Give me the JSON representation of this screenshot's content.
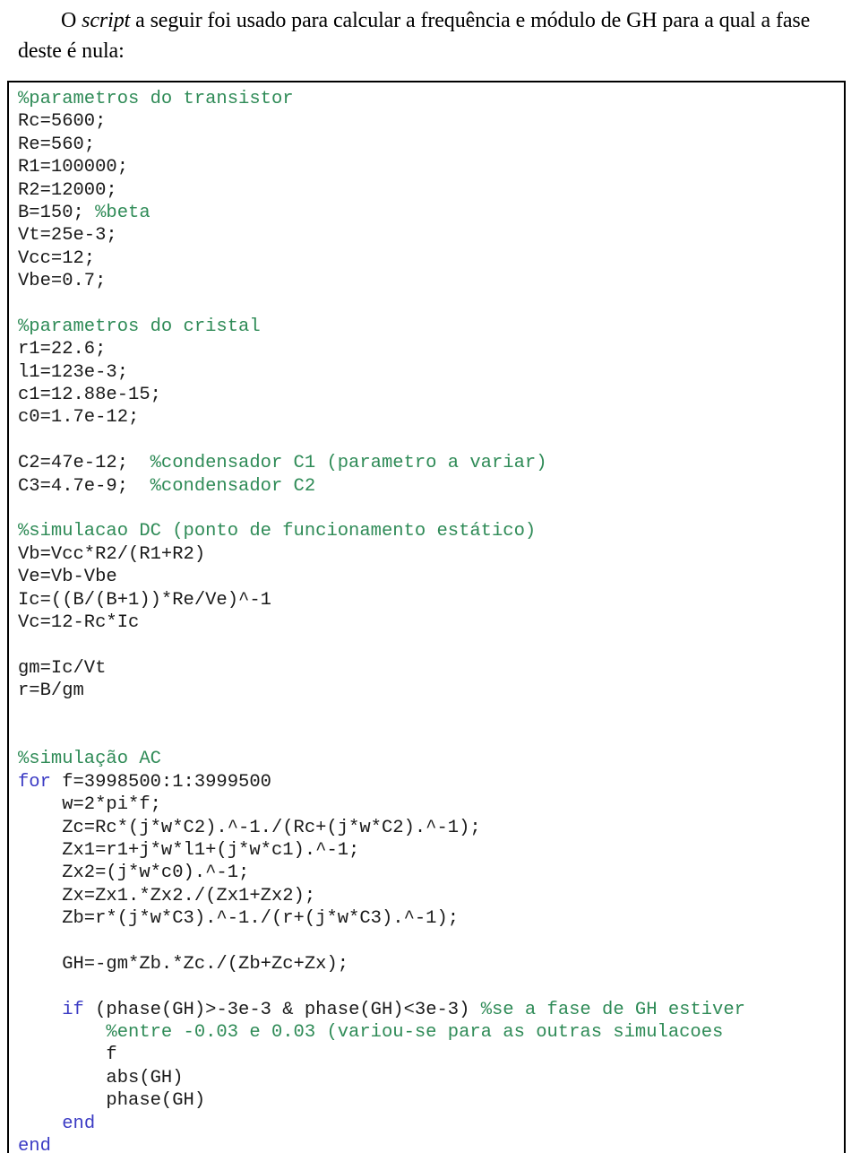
{
  "intro": {
    "before_italic": "O ",
    "italic_word": "script",
    "after_italic": " a seguir foi usado para calcular a frequência e módulo de GH para a qual a fase deste é nula:"
  },
  "colors": {
    "comment": "#2f8b57",
    "keyword": "#3b3bc4",
    "code": "#1a1a1a",
    "border": "#000000",
    "background": "#ffffff"
  },
  "code": {
    "language": "MATLAB",
    "lines": [
      {
        "type": "comment",
        "text": "%parametros do transistor"
      },
      {
        "type": "code",
        "text": "Rc=5600;"
      },
      {
        "type": "code",
        "text": "Re=560;"
      },
      {
        "type": "code",
        "text": "R1=100000;"
      },
      {
        "type": "code",
        "text": "R2=12000;"
      },
      {
        "type": "mixed",
        "code": "B=150; ",
        "comment": "%beta"
      },
      {
        "type": "code",
        "text": "Vt=25e-3;"
      },
      {
        "type": "code",
        "text": "Vcc=12;"
      },
      {
        "type": "code",
        "text": "Vbe=0.7;"
      },
      {
        "type": "blank",
        "text": ""
      },
      {
        "type": "comment",
        "text": "%parametros do cristal"
      },
      {
        "type": "code",
        "text": "r1=22.6;"
      },
      {
        "type": "code",
        "text": "l1=123e-3;"
      },
      {
        "type": "code",
        "text": "c1=12.88e-15;"
      },
      {
        "type": "code",
        "text": "c0=1.7e-12;"
      },
      {
        "type": "blank",
        "text": ""
      },
      {
        "type": "mixed",
        "code": "C2=47e-12;  ",
        "comment": "%condensador C1 (parametro a variar)"
      },
      {
        "type": "mixed",
        "code": "C3=4.7e-9;  ",
        "comment": "%condensador C2"
      },
      {
        "type": "blank",
        "text": ""
      },
      {
        "type": "comment",
        "text": "%simulacao DC (ponto de funcionamento estático)"
      },
      {
        "type": "code",
        "text": "Vb=Vcc*R2/(R1+R2)"
      },
      {
        "type": "code",
        "text": "Ve=Vb-Vbe"
      },
      {
        "type": "code",
        "text": "Ic=((B/(B+1))*Re/Ve)^-1"
      },
      {
        "type": "code",
        "text": "Vc=12-Rc*Ic"
      },
      {
        "type": "blank",
        "text": ""
      },
      {
        "type": "code",
        "text": "gm=Ic/Vt"
      },
      {
        "type": "code",
        "text": "r=B/gm"
      },
      {
        "type": "blank",
        "text": ""
      },
      {
        "type": "blank",
        "text": ""
      },
      {
        "type": "comment",
        "text": "%simulação AC"
      },
      {
        "type": "kwstart",
        "keyword": "for",
        "text": " f=3998500:1:3999500"
      },
      {
        "type": "code",
        "text": "    w=2*pi*f;"
      },
      {
        "type": "code",
        "text": "    Zc=Rc*(j*w*C2).^-1./(Rc+(j*w*C2).^-1);"
      },
      {
        "type": "code",
        "text": "    Zx1=r1+j*w*l1+(j*w*c1).^-1;"
      },
      {
        "type": "code",
        "text": "    Zx2=(j*w*c0).^-1;"
      },
      {
        "type": "code",
        "text": "    Zx=Zx1.*Zx2./(Zx1+Zx2);"
      },
      {
        "type": "code",
        "text": "    Zb=r*(j*w*C3).^-1./(r+(j*w*C3).^-1);"
      },
      {
        "type": "blank",
        "text": ""
      },
      {
        "type": "code",
        "text": "    GH=-gm*Zb.*Zc./(Zb+Zc+Zx);"
      },
      {
        "type": "blank",
        "text": ""
      },
      {
        "type": "kwmixed",
        "indent": "    ",
        "keyword": "if",
        "code": " (phase(GH)>-3e-3 & phase(GH)<3e-3) ",
        "comment": "%se a fase de GH estiver"
      },
      {
        "type": "comment",
        "text": "        %entre -0.03 e 0.03 (variou-se para as outras simulacoes"
      },
      {
        "type": "code",
        "text": "        f"
      },
      {
        "type": "code",
        "text": "        abs(GH)"
      },
      {
        "type": "code",
        "text": "        phase(GH)"
      },
      {
        "type": "kwonly",
        "indent": "    ",
        "keyword": "end"
      },
      {
        "type": "kwonly",
        "indent": "",
        "keyword": "end"
      }
    ]
  }
}
